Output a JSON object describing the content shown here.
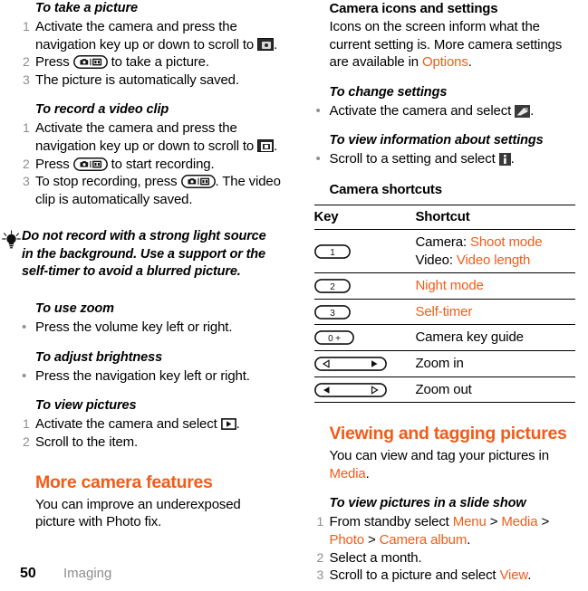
{
  "page": {
    "number": "50",
    "section": "Imaging"
  },
  "colors": {
    "accent": "#f25c19",
    "muted": "#8e8e8e",
    "text": "#000000"
  },
  "left_column": {
    "take_picture": {
      "heading": "To take a picture",
      "steps": [
        {
          "num": "1",
          "before": "Activate the camera and press the navigation key up or down to scroll to ",
          "icon": "camera-mode-icon",
          "after": "."
        },
        {
          "num": "2",
          "before": "Press ",
          "icon": "camera-key-icon",
          "after": " to take a picture."
        },
        {
          "num": "3",
          "before": "The picture is automatically saved.",
          "icon": "",
          "after": ""
        }
      ]
    },
    "record_video": {
      "heading": "To record a video clip",
      "steps": [
        {
          "num": "1",
          "before": "Activate the camera and press the navigation key up or down to scroll to ",
          "icon": "video-mode-icon",
          "after": "."
        },
        {
          "num": "2",
          "before": "Press ",
          "icon": "camera-key-icon",
          "after": " to start recording."
        },
        {
          "num": "3",
          "before": "To stop recording, press ",
          "icon": "camera-key-icon",
          "after": ". The video clip is automatically saved."
        }
      ]
    },
    "tip": {
      "icon": "lightbulb-icon",
      "text": "Do not record with a strong light source in the background. Use a support or the self-timer to avoid a blurred picture."
    },
    "use_zoom": {
      "heading": "To use zoom",
      "bullets": [
        "Press the volume key left or right."
      ]
    },
    "adjust_brightness": {
      "heading": "To adjust brightness",
      "bullets": [
        "Press the navigation key left or right."
      ]
    },
    "view_pictures": {
      "heading": "To view pictures",
      "steps": [
        {
          "num": "1",
          "before": "Activate the camera and select ",
          "icon": "play-icon",
          "after": "."
        },
        {
          "num": "2",
          "before": "Scroll to the item.",
          "icon": "",
          "after": ""
        }
      ]
    },
    "more_camera_features": {
      "heading": "More camera features",
      "body": "You can improve an underexposed picture with Photo fix."
    }
  },
  "right_column": {
    "camera_icons_settings": {
      "heading": "Camera icons and settings",
      "body_before": "Icons on the screen inform what the current setting is. More camera settings are available in ",
      "body_ref": "Options",
      "body_after": "."
    },
    "change_settings": {
      "heading": "To change settings",
      "bullet_before": "Activate the camera and select ",
      "bullet_icon": "settings-icon",
      "bullet_after": "."
    },
    "view_info_settings": {
      "heading": "To view information about settings",
      "bullet_before": "Scroll to a setting and select ",
      "bullet_icon": "info-icon",
      "bullet_after": "."
    },
    "camera_shortcuts": {
      "heading": "Camera shortcuts",
      "columns": [
        "Key",
        "Shortcut"
      ],
      "rows": [
        {
          "key_icon": "key-1-icon",
          "key_label": "1",
          "lines": [
            {
              "prefix": "Camera: ",
              "ref": "Shoot mode"
            },
            {
              "prefix": "Video: ",
              "ref": "Video length"
            }
          ]
        },
        {
          "key_icon": "key-2-icon",
          "key_label": "2",
          "lines": [
            {
              "prefix": "",
              "ref": "Night mode"
            }
          ]
        },
        {
          "key_icon": "key-3-icon",
          "key_label": "3",
          "lines": [
            {
              "prefix": "",
              "ref": "Self-timer"
            }
          ]
        },
        {
          "key_icon": "key-0-plus-icon",
          "key_label": "0 +",
          "lines": [
            {
              "prefix": "Camera key guide",
              "ref": ""
            }
          ]
        },
        {
          "key_icon": "zoom-in-key-icon",
          "key_label": "",
          "lines": [
            {
              "prefix": "Zoom in",
              "ref": ""
            }
          ]
        },
        {
          "key_icon": "zoom-out-key-icon",
          "key_label": "",
          "lines": [
            {
              "prefix": "Zoom out",
              "ref": ""
            }
          ]
        }
      ]
    },
    "viewing_tagging": {
      "heading": "Viewing and tagging pictures",
      "body_before": "You can view and tag your pictures in ",
      "body_ref": "Media",
      "body_after": "."
    },
    "slide_show": {
      "heading": "To view pictures in a slide show",
      "steps": [
        {
          "num": "1",
          "parts": [
            {
              "t": "From standby select ",
              "ref": false
            },
            {
              "t": "Menu",
              "ref": true
            },
            {
              "t": " > ",
              "ref": false
            },
            {
              "t": "Media",
              "ref": true
            },
            {
              "t": " > ",
              "ref": false
            },
            {
              "t": "Photo",
              "ref": true
            },
            {
              "t": " > ",
              "ref": false
            },
            {
              "t": "Camera album",
              "ref": true
            },
            {
              "t": ".",
              "ref": false
            }
          ]
        },
        {
          "num": "2",
          "parts": [
            {
              "t": "Select a month.",
              "ref": false
            }
          ]
        },
        {
          "num": "3",
          "parts": [
            {
              "t": "Scroll to a picture and select ",
              "ref": false
            },
            {
              "t": "View",
              "ref": true
            },
            {
              "t": ".",
              "ref": false
            }
          ]
        }
      ]
    }
  }
}
